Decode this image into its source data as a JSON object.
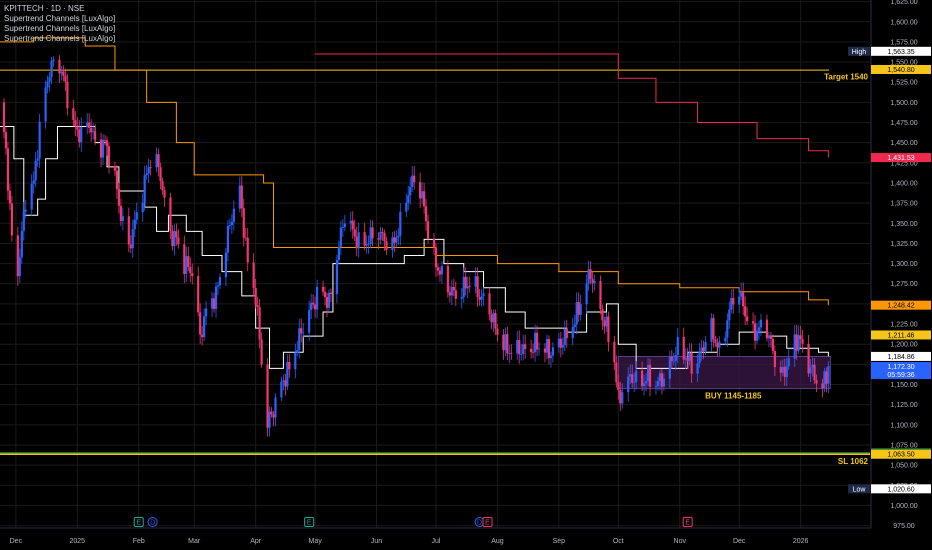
{
  "symbol": {
    "title": "KPITTECH · 1D · NSE",
    "indicators": [
      "Supertrend Channels [LuxAlgo]",
      "Supertrend Channels [LuxAlgo]",
      "Supertrend Channels [LuxAlgo]"
    ]
  },
  "colors": {
    "background": "#000000",
    "grid": "#1a1a1a",
    "candle_up": "#2962ff",
    "candle_down": "#f23672",
    "line_white": "#ffffff",
    "line_yellow": "#f5c518",
    "line_orange": "#ff9800",
    "line_red": "#f2294f",
    "line_green": "#2e7d32",
    "zone_fill": "#3b1a48"
  },
  "annotations": {
    "target": "Target 1540",
    "buy": "BUY 1145-1185",
    "sl": "SL 1062"
  },
  "price_tags": [
    {
      "text": "1,563.35",
      "prefix": "High",
      "value": 1563.35,
      "bg": "#ffffff",
      "fg": "#000000",
      "prefix_bg": "#1e2a4a",
      "prefix_fg": "#ffffff"
    },
    {
      "text": "1,540.80",
      "value": 1540.8,
      "bg": "#f5c518",
      "fg": "#000000"
    },
    {
      "text": "1,431.53",
      "value": 1431.53,
      "bg": "#f2294f",
      "fg": "#ffffff"
    },
    {
      "text": "1,248.42",
      "value": 1248.42,
      "bg": "#ff9800",
      "fg": "#000000"
    },
    {
      "text": "1,211.46",
      "value": 1211.46,
      "bg": "#f5c518",
      "fg": "#000000"
    },
    {
      "text": "1,184.86",
      "value": 1184.86,
      "bg": "#ffffff",
      "fg": "#000000"
    },
    {
      "text": "1,172.30",
      "value": 1172.3,
      "bg": "#2962ff",
      "fg": "#ffffff",
      "sub": "05:59:36"
    },
    {
      "text": "1,065.30",
      "value": 1065.3,
      "bg": "#2e7d32",
      "fg": "#ffffff"
    },
    {
      "text": "1,063.50",
      "value": 1063.5,
      "bg": "#f5c518",
      "fg": "#000000"
    },
    {
      "text": "1,020.60",
      "prefix": "Low",
      "value": 1020.6,
      "bg": "#ffffff",
      "fg": "#000000",
      "prefix_bg": "#1e2a4a",
      "prefix_fg": "#ffffff"
    }
  ],
  "event_markers": [
    {
      "label": "E",
      "x": "2025-02-01",
      "color": "#26a69a"
    },
    {
      "label": "D",
      "x": "2025-02-08",
      "color": "#2962ff"
    },
    {
      "label": "E",
      "x": "2025-04-28",
      "color": "#26a69a"
    },
    {
      "label": "D",
      "x": "2025-07-23",
      "color": "#2962ff"
    },
    {
      "label": "E",
      "x": "2025-07-27",
      "color": "#f23672"
    },
    {
      "label": "E",
      "x": "2025-11-05",
      "color": "#f23672"
    }
  ],
  "chart_data": {
    "type": "candlestick",
    "x_range": [
      "2024-11-23",
      "2026-02-05"
    ],
    "ylim": [
      972,
      1627
    ],
    "y_ticks": [
      975,
      1000,
      1025,
      1050,
      1075,
      1100,
      1125,
      1150,
      1175,
      1200,
      1225,
      1250,
      1275,
      1300,
      1325,
      1350,
      1375,
      1400,
      1425,
      1450,
      1475,
      1500,
      1525,
      1550,
      1575,
      1600,
      1625
    ],
    "y_tick_labels": [
      "975.00",
      "1,000.00",
      "1,025.00",
      "1,050.00",
      "1,075.00",
      "1,100.00",
      "1,125.00",
      "1,150.00",
      "1,175.00",
      "1,200.00",
      "1,225.00",
      "1,250.00",
      "1,275.00",
      "1,300.00",
      "1,325.00",
      "1,350.00",
      "1,375.00",
      "1,400.00",
      "1,425.00",
      "1,450.00",
      "1,475.00",
      "1,500.00",
      "1,525.00",
      "1,550.00",
      "1,575.00",
      "1,600.00",
      "1,625.00"
    ],
    "x_ticks": [
      {
        "date": "2024-12-01",
        "label": "Dec"
      },
      {
        "date": "2025-01-01",
        "label": "2025"
      },
      {
        "date": "2025-02-01",
        "label": "Feb"
      },
      {
        "date": "2025-03-01",
        "label": "Mar"
      },
      {
        "date": "2025-04-01",
        "label": "Apr"
      },
      {
        "date": "2025-05-01",
        "label": "May"
      },
      {
        "date": "2025-06-01",
        "label": "Jun"
      },
      {
        "date": "2025-07-01",
        "label": "Jul"
      },
      {
        "date": "2025-08-01",
        "label": "Aug"
      },
      {
        "date": "2025-09-01",
        "label": "Sep"
      },
      {
        "date": "2025-10-01",
        "label": "Oct"
      },
      {
        "date": "2025-11-01",
        "label": "Nov"
      },
      {
        "date": "2025-12-01",
        "label": "Dec"
      },
      {
        "date": "2026-01-01",
        "label": "2026"
      }
    ],
    "close_path": [
      [
        "2024-11-23",
        1500
      ],
      [
        "2024-11-26",
        1440
      ],
      [
        "2024-11-29",
        1330
      ],
      [
        "2024-12-02",
        1290
      ],
      [
        "2024-12-06",
        1380
      ],
      [
        "2024-12-10",
        1400
      ],
      [
        "2024-12-14",
        1490
      ],
      [
        "2024-12-18",
        1540
      ],
      [
        "2024-12-22",
        1555
      ],
      [
        "2024-12-26",
        1520
      ],
      [
        "2024-12-30",
        1470
      ],
      [
        "2025-01-03",
        1460
      ],
      [
        "2025-01-07",
        1475
      ],
      [
        "2025-01-11",
        1440
      ],
      [
        "2025-01-15",
        1450
      ],
      [
        "2025-01-19",
        1420
      ],
      [
        "2025-01-23",
        1360
      ],
      [
        "2025-01-27",
        1320
      ],
      [
        "2025-01-31",
        1360
      ],
      [
        "2025-02-04",
        1400
      ],
      [
        "2025-02-08",
        1440
      ],
      [
        "2025-02-12",
        1410
      ],
      [
        "2025-02-16",
        1340
      ],
      [
        "2025-02-20",
        1330
      ],
      [
        "2025-02-24",
        1300
      ],
      [
        "2025-02-28",
        1290
      ],
      [
        "2025-03-04",
        1210
      ],
      [
        "2025-03-08",
        1250
      ],
      [
        "2025-03-12",
        1260
      ],
      [
        "2025-03-16",
        1310
      ],
      [
        "2025-03-20",
        1360
      ],
      [
        "2025-03-24",
        1390
      ],
      [
        "2025-03-28",
        1300
      ],
      [
        "2025-04-01",
        1260
      ],
      [
        "2025-04-04",
        1180
      ],
      [
        "2025-04-07",
        1100
      ],
      [
        "2025-04-10",
        1120
      ],
      [
        "2025-04-14",
        1150
      ],
      [
        "2025-04-18",
        1170
      ],
      [
        "2025-04-22",
        1200
      ],
      [
        "2025-04-26",
        1230
      ],
      [
        "2025-04-30",
        1250
      ],
      [
        "2025-05-04",
        1270
      ],
      [
        "2025-05-08",
        1250
      ],
      [
        "2025-05-12",
        1310
      ],
      [
        "2025-05-16",
        1360
      ],
      [
        "2025-05-20",
        1340
      ],
      [
        "2025-05-24",
        1320
      ],
      [
        "2025-05-28",
        1330
      ],
      [
        "2025-06-01",
        1340
      ],
      [
        "2025-06-05",
        1330
      ],
      [
        "2025-06-09",
        1320
      ],
      [
        "2025-06-13",
        1350
      ],
      [
        "2025-06-17",
        1390
      ],
      [
        "2025-06-21",
        1410
      ],
      [
        "2025-06-25",
        1370
      ],
      [
        "2025-06-29",
        1310
      ],
      [
        "2025-07-03",
        1290
      ],
      [
        "2025-07-07",
        1270
      ],
      [
        "2025-07-11",
        1260
      ],
      [
        "2025-07-15",
        1270
      ],
      [
        "2025-07-19",
        1280
      ],
      [
        "2025-07-23",
        1260
      ],
      [
        "2025-07-27",
        1250
      ],
      [
        "2025-07-31",
        1220
      ],
      [
        "2025-08-04",
        1200
      ],
      [
        "2025-08-08",
        1190
      ],
      [
        "2025-08-12",
        1195
      ],
      [
        "2025-08-16",
        1190
      ],
      [
        "2025-08-20",
        1200
      ],
      [
        "2025-08-24",
        1195
      ],
      [
        "2025-08-28",
        1190
      ],
      [
        "2025-09-01",
        1200
      ],
      [
        "2025-09-05",
        1210
      ],
      [
        "2025-09-09",
        1230
      ],
      [
        "2025-09-13",
        1260
      ],
      [
        "2025-09-17",
        1290
      ],
      [
        "2025-09-21",
        1250
      ],
      [
        "2025-09-25",
        1220
      ],
      [
        "2025-09-29",
        1180
      ],
      [
        "2025-10-01",
        1130
      ],
      [
        "2025-10-04",
        1150
      ],
      [
        "2025-10-08",
        1160
      ],
      [
        "2025-10-12",
        1150
      ],
      [
        "2025-10-16",
        1160
      ],
      [
        "2025-10-20",
        1150
      ],
      [
        "2025-10-24",
        1160
      ],
      [
        "2025-10-28",
        1180
      ],
      [
        "2025-11-01",
        1200
      ],
      [
        "2025-11-05",
        1180
      ],
      [
        "2025-11-09",
        1170
      ],
      [
        "2025-11-13",
        1200
      ],
      [
        "2025-11-17",
        1220
      ],
      [
        "2025-11-21",
        1190
      ],
      [
        "2025-11-25",
        1230
      ],
      [
        "2025-11-29",
        1270
      ],
      [
        "2025-12-03",
        1250
      ],
      [
        "2025-12-07",
        1210
      ],
      [
        "2025-12-11",
        1220
      ],
      [
        "2025-12-15",
        1220
      ],
      [
        "2025-12-19",
        1180
      ],
      [
        "2025-12-23",
        1160
      ],
      [
        "2025-12-27",
        1190
      ],
      [
        "2025-12-31",
        1210
      ],
      [
        "2026-01-04",
        1180
      ],
      [
        "2026-01-08",
        1160
      ],
      [
        "2026-01-12",
        1145
      ],
      [
        "2026-01-15",
        1172.3
      ]
    ],
    "series": [
      {
        "name": "Supertrend Channels [LuxAlgo]",
        "color": "#ffffff",
        "points": [
          [
            "2024-11-23",
            1470
          ],
          [
            "2024-11-30",
            1430
          ],
          [
            "2024-12-05",
            1360
          ],
          [
            "2024-12-12",
            1380
          ],
          [
            "2024-12-16",
            1430
          ],
          [
            "2024-12-22",
            1470
          ],
          [
            "2025-01-05",
            1470
          ],
          [
            "2025-01-10",
            1450
          ],
          [
            "2025-01-16",
            1420
          ],
          [
            "2025-01-22",
            1390
          ],
          [
            "2025-02-04",
            1370
          ],
          [
            "2025-02-10",
            1340
          ],
          [
            "2025-02-16",
            1360
          ],
          [
            "2025-02-25",
            1340
          ],
          [
            "2025-03-05",
            1310
          ],
          [
            "2025-03-15",
            1290
          ],
          [
            "2025-03-25",
            1260
          ],
          [
            "2025-04-01",
            1220
          ],
          [
            "2025-04-08",
            1170
          ],
          [
            "2025-04-15",
            1190
          ],
          [
            "2025-04-25",
            1210
          ],
          [
            "2025-05-05",
            1240
          ],
          [
            "2025-05-10",
            1300
          ],
          [
            "2025-05-30",
            1300
          ],
          [
            "2025-06-15",
            1310
          ],
          [
            "2025-06-25",
            1330
          ],
          [
            "2025-07-05",
            1300
          ],
          [
            "2025-07-15",
            1290
          ],
          [
            "2025-07-25",
            1270
          ],
          [
            "2025-08-05",
            1240
          ],
          [
            "2025-08-15",
            1220
          ],
          [
            "2025-08-25",
            1220
          ],
          [
            "2025-09-05",
            1215
          ],
          [
            "2025-09-15",
            1240
          ],
          [
            "2025-09-25",
            1250
          ],
          [
            "2025-10-01",
            1200
          ],
          [
            "2025-10-10",
            1170
          ],
          [
            "2025-10-25",
            1170
          ],
          [
            "2025-11-05",
            1190
          ],
          [
            "2025-11-20",
            1200
          ],
          [
            "2025-12-01",
            1215
          ],
          [
            "2025-12-15",
            1210
          ],
          [
            "2025-12-25",
            1195
          ],
          [
            "2026-01-10",
            1190
          ],
          [
            "2026-01-15",
            1184.86
          ]
        ]
      },
      {
        "name": "Supertrend Channels [LuxAlgo]",
        "color": "#f5c518",
        "points": [
          [
            "2024-11-23",
            1540
          ],
          [
            "2024-12-15",
            1540
          ],
          [
            "2025-02-15",
            1540
          ],
          [
            "2025-03-20",
            1540
          ],
          [
            "2025-05-15",
            1540
          ],
          [
            "2025-06-15",
            1540
          ],
          [
            "2025-08-01",
            1540
          ],
          [
            "2025-10-01",
            1540
          ],
          [
            "2026-01-15",
            1540.8
          ]
        ]
      },
      {
        "name": "Supertrend Channels [LuxAlgo]",
        "color": "#ff9800",
        "points": [
          [
            "2024-11-23",
            1575
          ],
          [
            "2024-12-10",
            1580
          ],
          [
            "2025-01-05",
            1570
          ],
          [
            "2025-01-20",
            1540
          ],
          [
            "2025-02-05",
            1500
          ],
          [
            "2025-02-20",
            1450
          ],
          [
            "2025-03-01",
            1410
          ],
          [
            "2025-04-05",
            1400
          ],
          [
            "2025-04-10",
            1320
          ],
          [
            "2025-06-01",
            1320
          ],
          [
            "2025-07-01",
            1310
          ],
          [
            "2025-08-01",
            1300
          ],
          [
            "2025-09-01",
            1290
          ],
          [
            "2025-10-01",
            1275
          ],
          [
            "2025-11-01",
            1270
          ],
          [
            "2025-12-01",
            1265
          ],
          [
            "2026-01-05",
            1255
          ],
          [
            "2026-01-15",
            1248.42
          ]
        ]
      },
      {
        "name": "Supertrend Channels [LuxAlgo]",
        "color": "#f2294f",
        "points": [
          [
            "2025-05-01",
            1560
          ],
          [
            "2025-09-15",
            1560
          ],
          [
            "2025-10-01",
            1530
          ],
          [
            "2025-10-20",
            1500
          ],
          [
            "2025-11-10",
            1475
          ],
          [
            "2025-12-10",
            1455
          ],
          [
            "2026-01-05",
            1440
          ],
          [
            "2026-01-15",
            1431.53
          ]
        ]
      }
    ],
    "zones": [
      {
        "from": "2025-10-01",
        "to": "2026-01-16",
        "low": 1145,
        "high": 1185
      }
    ],
    "horizontal_lines": [
      {
        "value": 1065.3,
        "color": "#2e7d32"
      },
      {
        "value": 1063.5,
        "color": "#f5c518"
      }
    ]
  }
}
